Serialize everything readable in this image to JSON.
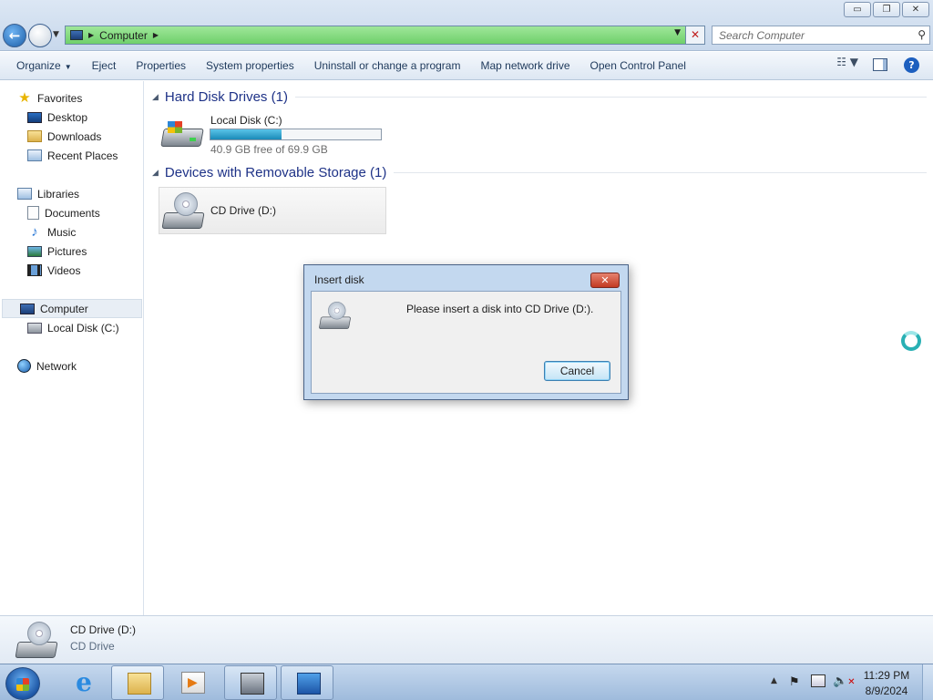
{
  "window": {
    "controls": {
      "minimize": "▭",
      "restore": "❐",
      "close": "✕"
    }
  },
  "nav": {
    "back_glyph": "←",
    "address": "Computer",
    "search_placeholder": "Search Computer"
  },
  "toolbar": {
    "items": [
      "Organize",
      "Eject",
      "Properties",
      "System properties",
      "Uninstall or change a program",
      "Map network drive",
      "Open Control Panel"
    ],
    "help_glyph": "?"
  },
  "sidebar": {
    "favorites": {
      "label": "Favorites",
      "items": [
        "Desktop",
        "Downloads",
        "Recent Places"
      ]
    },
    "libraries": {
      "label": "Libraries",
      "items": [
        "Documents",
        "Music",
        "Pictures",
        "Videos"
      ]
    },
    "computer": {
      "label": "Computer",
      "items": [
        "Local Disk (C:)"
      ]
    },
    "network": {
      "label": "Network"
    }
  },
  "content": {
    "hard_disk_header": "Hard Disk Drives (1)",
    "local_disk": {
      "name": "Local Disk (C:)",
      "free_text": "40.9 GB free of 69.9 GB",
      "used_fraction": 0.415
    },
    "removable_header": "Devices with Removable Storage (1)",
    "cd_drive": {
      "name": "CD Drive (D:)"
    }
  },
  "details": {
    "name": "CD Drive (D:)",
    "type": "CD Drive"
  },
  "dialog": {
    "title": "Insert disk",
    "message": "Please insert a disk into CD Drive (D:).",
    "cancel_label": "Cancel",
    "close_glyph": "✕"
  },
  "taskbar": {
    "time": "11:29 PM",
    "date": "8/9/2024",
    "ie_glyph": "e"
  },
  "colors": {
    "address_bar": "#7fdc7a",
    "progress_fill": "#1a8ab8",
    "group_header": "#1e3287",
    "dialog_frame": "#c3d8ef"
  }
}
